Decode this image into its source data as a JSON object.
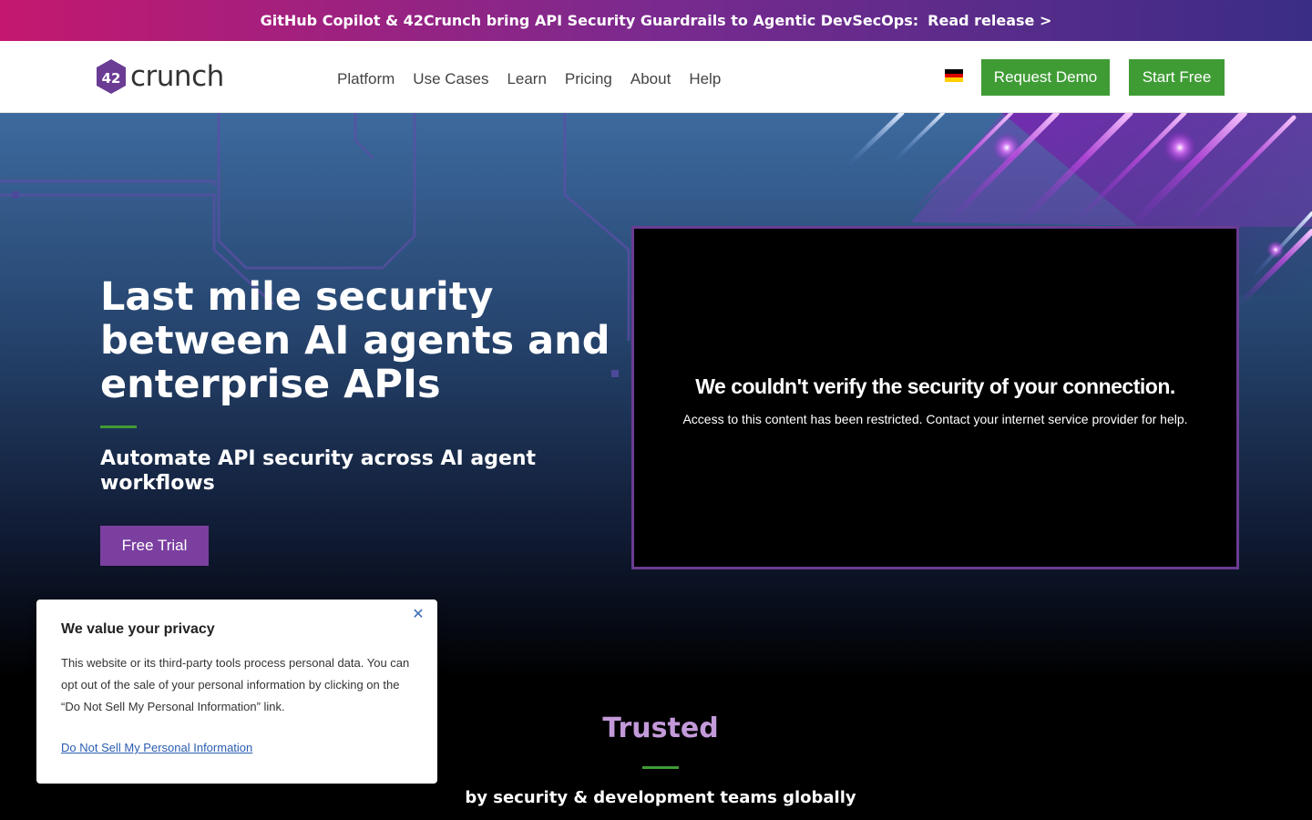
{
  "announcement": {
    "text": "GitHub Copilot & 42Crunch bring API Security Guardrails to Agentic DevSecOps:",
    "link": "Read release >"
  },
  "header": {
    "logo_mark": "42",
    "logo_word": "crunch",
    "nav": [
      "Platform",
      "Use Cases",
      "Learn",
      "Pricing",
      "About",
      "Help"
    ],
    "flag_icon": "german-flag-icon",
    "request_demo": "Request Demo",
    "start_free": "Start Free"
  },
  "hero": {
    "title": "Last mile security between AI agents and enterprise APIs",
    "subtitle": "Automate API security across AI agent workflows",
    "cta": "Free Trial"
  },
  "video": {
    "heading": "We couldn't verify the security of your connection.",
    "message": "Access to this content has been restricted. Contact your internet service provider for help."
  },
  "trusted": {
    "heading": "Trusted",
    "subheading": "by security & development teams globally"
  },
  "privacy": {
    "title": "We value your privacy",
    "body": "This website or its third-party tools process personal data. You can opt out of the sale of your personal information by clicking on the “Do Not Sell My Personal Information” link.",
    "link": "Do Not Sell My Personal Information",
    "close_icon": "close-icon"
  },
  "colors": {
    "brand_purple": "#7b3fa0",
    "brand_green": "#3f9c35"
  }
}
